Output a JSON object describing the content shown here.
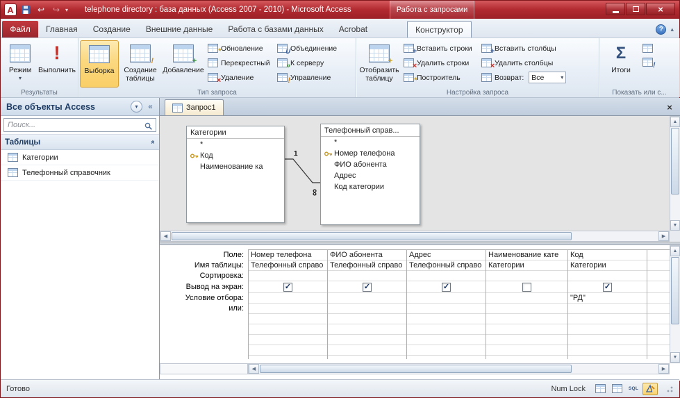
{
  "icons": {
    "app_letter": "A",
    "dropdown": "▾",
    "undo": "↩",
    "redo": "↪",
    "close_x": "×",
    "help": "?",
    "ribbon_collapse": "▴",
    "shutter": "«",
    "run": "!",
    "plus": "+",
    "excl": "!",
    "cross": "×",
    "star": "*",
    "union": "∪",
    "chev_right": "»",
    "sigma": "Σ",
    "check": "✓",
    "arrow_left": "◀",
    "arrow_right": "▶",
    "arrow_up": "▲",
    "arrow_down": "▼",
    "sql": "SQL"
  },
  "titlebar": {
    "title": "telephone directory : база данных (Access 2007 - 2010)  -  Microsoft Access",
    "context": "Работа с запросами"
  },
  "tabs": {
    "file": "Файл",
    "home": "Главная",
    "create": "Создание",
    "external": "Внешние данные",
    "dbtools": "Работа с базами данных",
    "acrobat": "Acrobat",
    "design": "Конструктор"
  },
  "ribbon": {
    "results": {
      "title": "Результаты",
      "mode": "Режим",
      "run": "Выполнить"
    },
    "qtype": {
      "title": "Тип запроса",
      "select": "Выборка",
      "make_table": "Создание таблицы",
      "append": "Добавление",
      "update": "Обновление",
      "crosstab": "Перекрестный",
      "del": "Удаление",
      "union": "Объединение",
      "passthrough": "К серверу",
      "ddl": "Управление"
    },
    "qsetup": {
      "title": "Настройка запроса",
      "show_table": "Отобразить таблицу",
      "ins_rows": "Вставить строки",
      "del_rows": "Удалить строки",
      "builder": "Построитель",
      "ins_cols": "Вставить столбцы",
      "del_cols": "Удалить столбцы",
      "return_label": "Возврат:",
      "return_value": "Все"
    },
    "showhide": {
      "title": "Показать или с...",
      "totals": "Итоги"
    }
  },
  "nav": {
    "header": "Все объекты Access",
    "search_placeholder": "Поиск...",
    "section": "Таблицы",
    "items": [
      "Категории",
      "Телефонный справочник"
    ]
  },
  "doc": {
    "tab": "Запрос1",
    "table1": {
      "title": "Категории",
      "fields": [
        "*",
        "Код",
        "Наименование ка"
      ]
    },
    "table2": {
      "title": "Телефонный справ...",
      "fields": [
        "*",
        "Номер телефона",
        "ФИО абонента",
        "Адрес",
        "Код категории"
      ]
    },
    "join": {
      "one": "1",
      "many": "∞"
    }
  },
  "grid": {
    "labels": [
      "Поле:",
      "Имя таблицы:",
      "Сортировка:",
      "Вывод на экран:",
      "Условие отбора:",
      "или:"
    ],
    "columns": [
      {
        "field": "Номер телефона",
        "table": "Телефонный справо",
        "show": true,
        "criteria": ""
      },
      {
        "field": "ФИО абонента",
        "table": "Телефонный справо",
        "show": true,
        "criteria": ""
      },
      {
        "field": "Адрес",
        "table": "Телефонный справо",
        "show": true,
        "criteria": ""
      },
      {
        "field": "Наименование кате",
        "table": "Категории",
        "show": false,
        "criteria": ""
      },
      {
        "field": "Код",
        "table": "Категории",
        "show": true,
        "criteria": "\"РД\""
      }
    ]
  },
  "status": {
    "ready": "Готово",
    "numlock": "Num Lock"
  }
}
